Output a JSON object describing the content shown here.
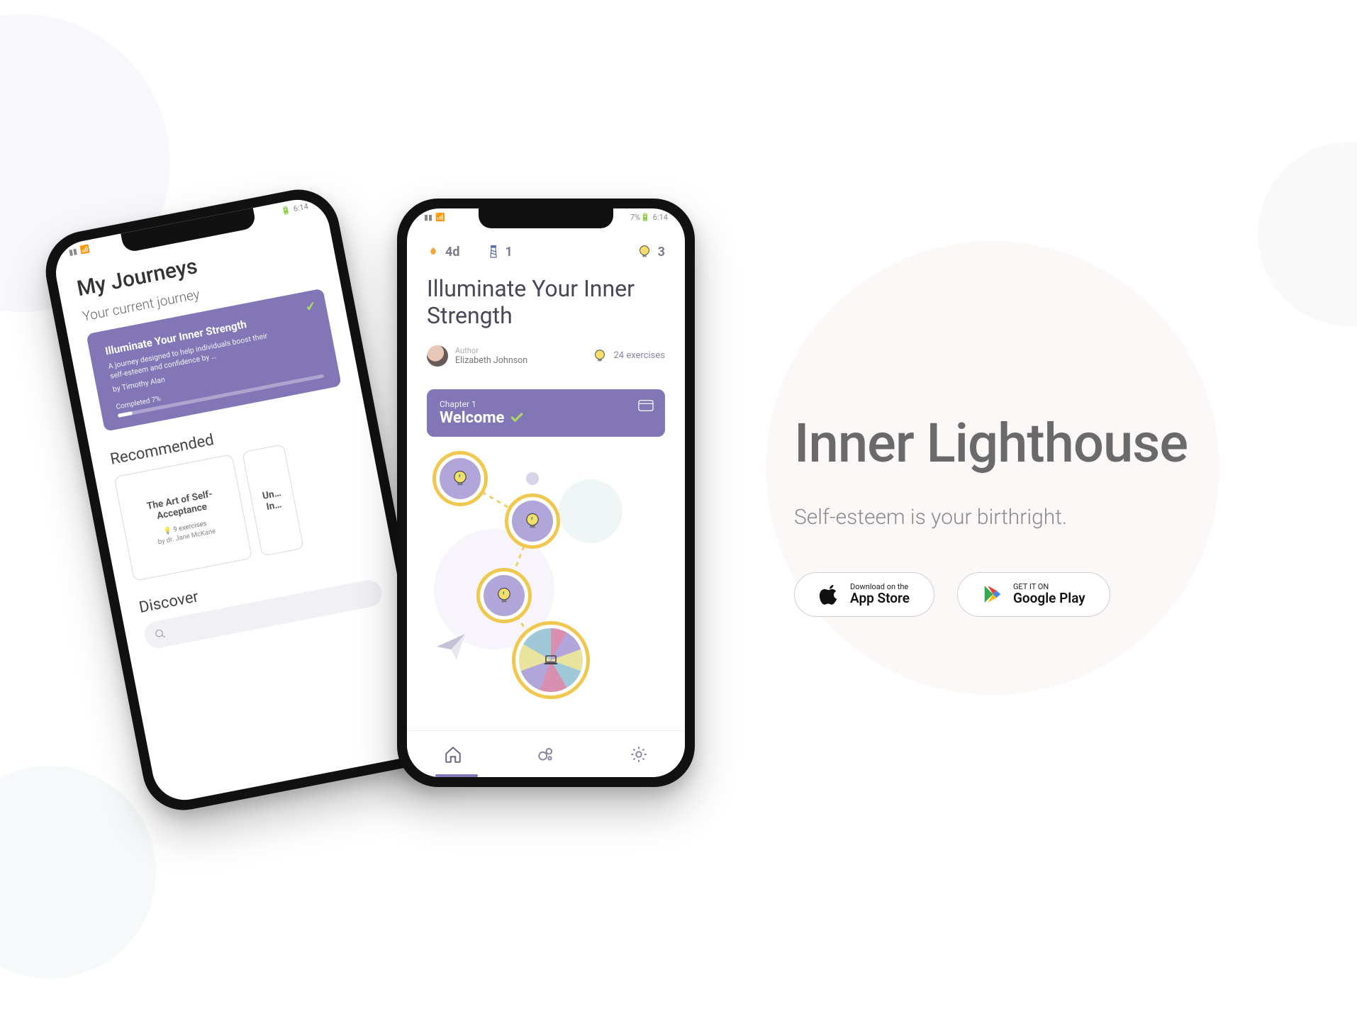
{
  "hero": {
    "title": "Inner Lighthouse",
    "tagline": "Self-esteem is your birthright.",
    "appstore_l1": "Download on the",
    "appstore_l2": "App Store",
    "gplay_l1": "GET IT ON",
    "gplay_l2": "Google Play"
  },
  "status_time": "6:14",
  "phone_a": {
    "heading": "My Journeys",
    "subheading": "Your current journey",
    "journey": {
      "title": "Illuminate Your Inner Strength",
      "desc": "A journey designed to help individuals boost their self-esteem and confidence by …",
      "author_prefix": "by",
      "author": "Timothy Alan",
      "progress_label": "Completed 7%"
    },
    "recommended_heading": "Recommended",
    "rec1": {
      "title": "The Art of Self-Acceptance",
      "meta": "9 exercises",
      "author": "by dr. Jane McKane"
    },
    "rec2": {
      "title": "Un…\nIn…"
    },
    "discover_heading": "Discover"
  },
  "phone_b": {
    "stats": {
      "streak": "4d",
      "lighthouse": "1",
      "bulbs": "3"
    },
    "title": "Illuminate Your Inner Strength",
    "author_label": "Author",
    "author_name": "Elizabeth Johnson",
    "exercises": "24 exercises",
    "chapter_label": "Chapter 1",
    "chapter_title": "Welcome"
  }
}
